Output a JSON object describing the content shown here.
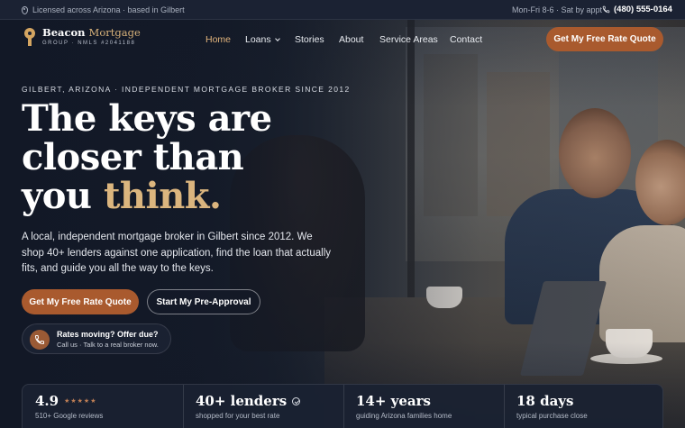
{
  "topbar": {
    "location": "Licensed across Arizona · based in Gilbert",
    "hours": "Mon-Fri 8-6 · Sat by appt",
    "phone": "(480) 555-0164"
  },
  "brand": {
    "name_main": "Beacon",
    "name_accent": "Mortgage",
    "subline": "GROUP · NMLS #2041188",
    "accent_color": "#a95a2e",
    "gold_color": "#dbb57e"
  },
  "nav": {
    "items": [
      "Home",
      "Loans",
      "Stories",
      "About",
      "Service Areas",
      "Contact"
    ],
    "cta": "Get My Free Rate Quote"
  },
  "hero": {
    "eyebrow": "GILBERT, ARIZONA · INDEPENDENT MORTGAGE BROKER SINCE 2012",
    "headline_line1": "The keys are",
    "headline_line2": "closer than",
    "headline_line3_prefix": "you",
    "headline_line3_accent": "think.",
    "lead": "A local, independent mortgage broker in Gilbert since 2012. We shop 40+ lenders against one application, find the loan that actually fits, and guide you all the way to the keys.",
    "primary_cta": "Get My Free Rate Quote",
    "secondary_cta": "Start My Pre-Approval",
    "call_title": "Rates moving? Offer due?",
    "call_sub": "Call us · Talk to a real broker now."
  },
  "stats": [
    {
      "value": "4.9",
      "stars": "★★★★★",
      "label": "510+ Google reviews"
    },
    {
      "value": "40+ lenders",
      "label": "shopped for your best rate"
    },
    {
      "value": "14+ years",
      "label": "guiding Arizona families home"
    },
    {
      "value": "18 days",
      "label": "typical purchase close"
    }
  ],
  "icons": {
    "location": "map-pin-icon",
    "phone": "phone-icon",
    "logo": "keyhole-icon",
    "dropdown": "chevron-down-icon",
    "verified": "check-circle-icon"
  }
}
